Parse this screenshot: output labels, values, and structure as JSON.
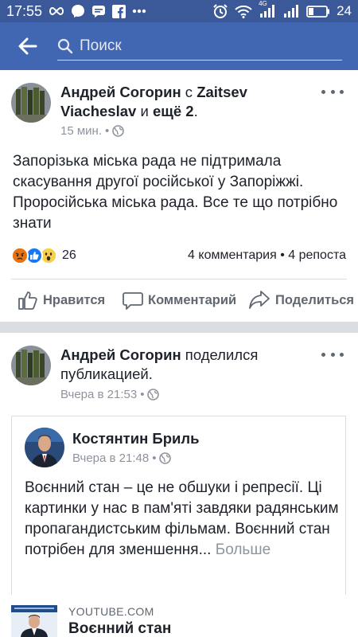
{
  "status_bar": {
    "time": "17:55",
    "network_label": "4G",
    "battery": "24",
    "icons": [
      "infinity-icon",
      "messenger-icon",
      "chat-icon",
      "facebook-icon",
      "more-dots-icon",
      "alarm-icon",
      "wifi-icon",
      "signal-icon",
      "battery-icon"
    ]
  },
  "search": {
    "placeholder": "Поиск"
  },
  "post1": {
    "author": "Андрей Согорин",
    "with_word": " с ",
    "tagged": "Zaitsev Viacheslav",
    "and_word": " и ",
    "others": "ещё 2",
    "period": ".",
    "time": "15 мин.",
    "privacy_icon": "globe-icon",
    "text": "Запорізька міська рада не підтримала скасування другої російської у Запоріжжі. Проросійська міська рада. Все те що потрібно знати",
    "reactions": [
      "angry",
      "like",
      "wow"
    ],
    "reaction_count": "26",
    "comments": "4 комментария",
    "shares": "4 репоста",
    "actions": {
      "like": "Нравится",
      "comment": "Комментарий",
      "share": "Поделиться"
    }
  },
  "post2": {
    "author": "Андрей Согорин",
    "action_text": " поделился публикацией.",
    "time": "Вчера в 21:53",
    "privacy_icon": "globe-icon",
    "shared": {
      "author": "Костянтин Бриль",
      "time": "Вчера в 21:48",
      "text": "Воєнний стан – це не  обшуки і репресії. Ці картинки у нас в пам'яті завдяки радянським пропагандистським фільмам. Воєнний стан потрібен для зменшення...",
      "more": "Больше"
    }
  },
  "link_preview": {
    "source": "YOUTUBE.COM",
    "title": "Воєнний стан"
  },
  "colors": {
    "header": "#4267b2",
    "status_bar": "#3b5998",
    "secondary_text": "#606770",
    "meta_text": "#8d949e"
  }
}
